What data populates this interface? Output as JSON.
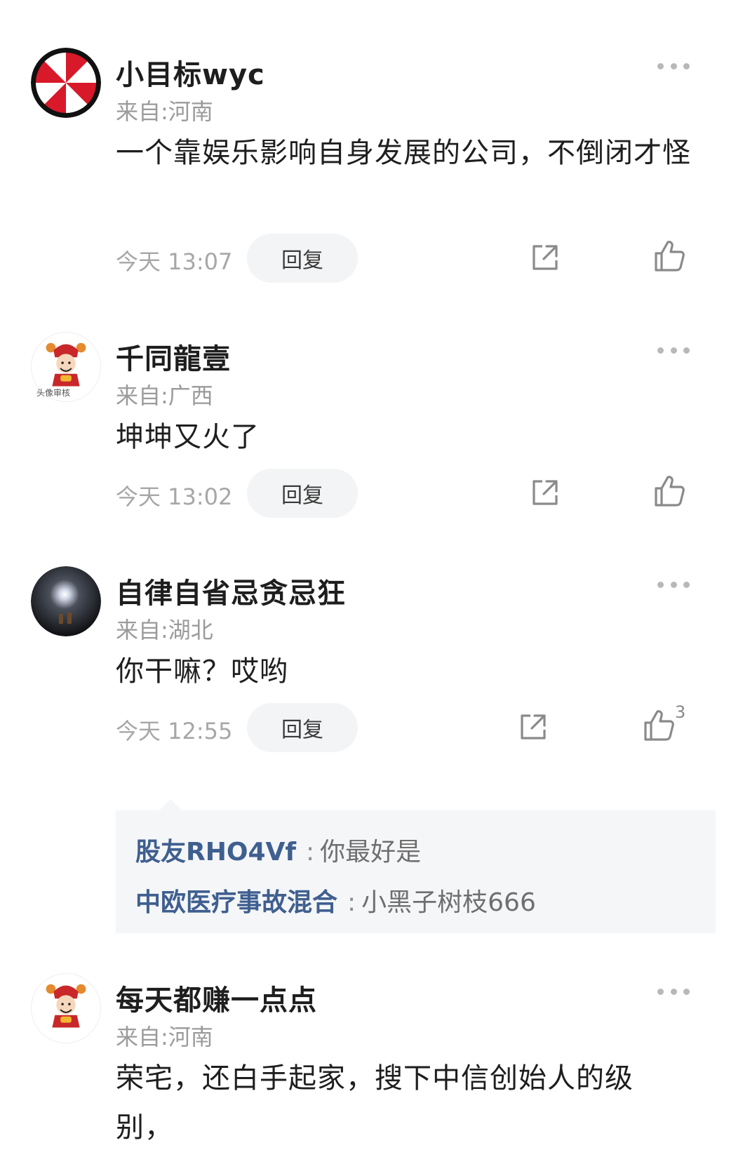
{
  "comments": [
    {
      "username": "小目标wyc",
      "location": "来自:河南",
      "text": "一个靠娱乐影响自身发展的公司，不倒闭才怪",
      "time": "今天 13:07",
      "reply_label": "回复",
      "avatar_icon": "umbrella-logo-icon"
    },
    {
      "username": "千同龍壹",
      "location": "来自:广西",
      "text": "坤坤又火了",
      "time": "今天 13:02",
      "reply_label": "回复",
      "avatar_icon": "fortune-god-avatar-icon",
      "avatar_badge": "头像审核"
    },
    {
      "username": "自律自省忌贪忌狂",
      "location": "来自:湖北",
      "text": "你干嘛？哎哟",
      "time": "今天 12:55",
      "reply_label": "回复",
      "avatar_icon": "night-light-avatar-icon",
      "like_count": "3",
      "sub_replies": [
        {
          "name": "股友RHO4Vf",
          "sep": ":",
          "text": "你最好是"
        },
        {
          "name": "中欧医疗事故混合",
          "sep": ":",
          "text": "小黑子树枝666"
        }
      ]
    },
    {
      "username": "每天都赚一点点",
      "location": "来自:河南",
      "text": "荣宅，还白手起家，搜下中信创始人的级别，",
      "avatar_icon": "fortune-god-avatar-icon"
    }
  ],
  "icons": {
    "more": "more-dots-icon",
    "share": "share-icon",
    "like": "thumbs-up-icon"
  },
  "colors": {
    "sub_reply_name": "#3f5f8f",
    "muted": "#9b9b9b"
  }
}
